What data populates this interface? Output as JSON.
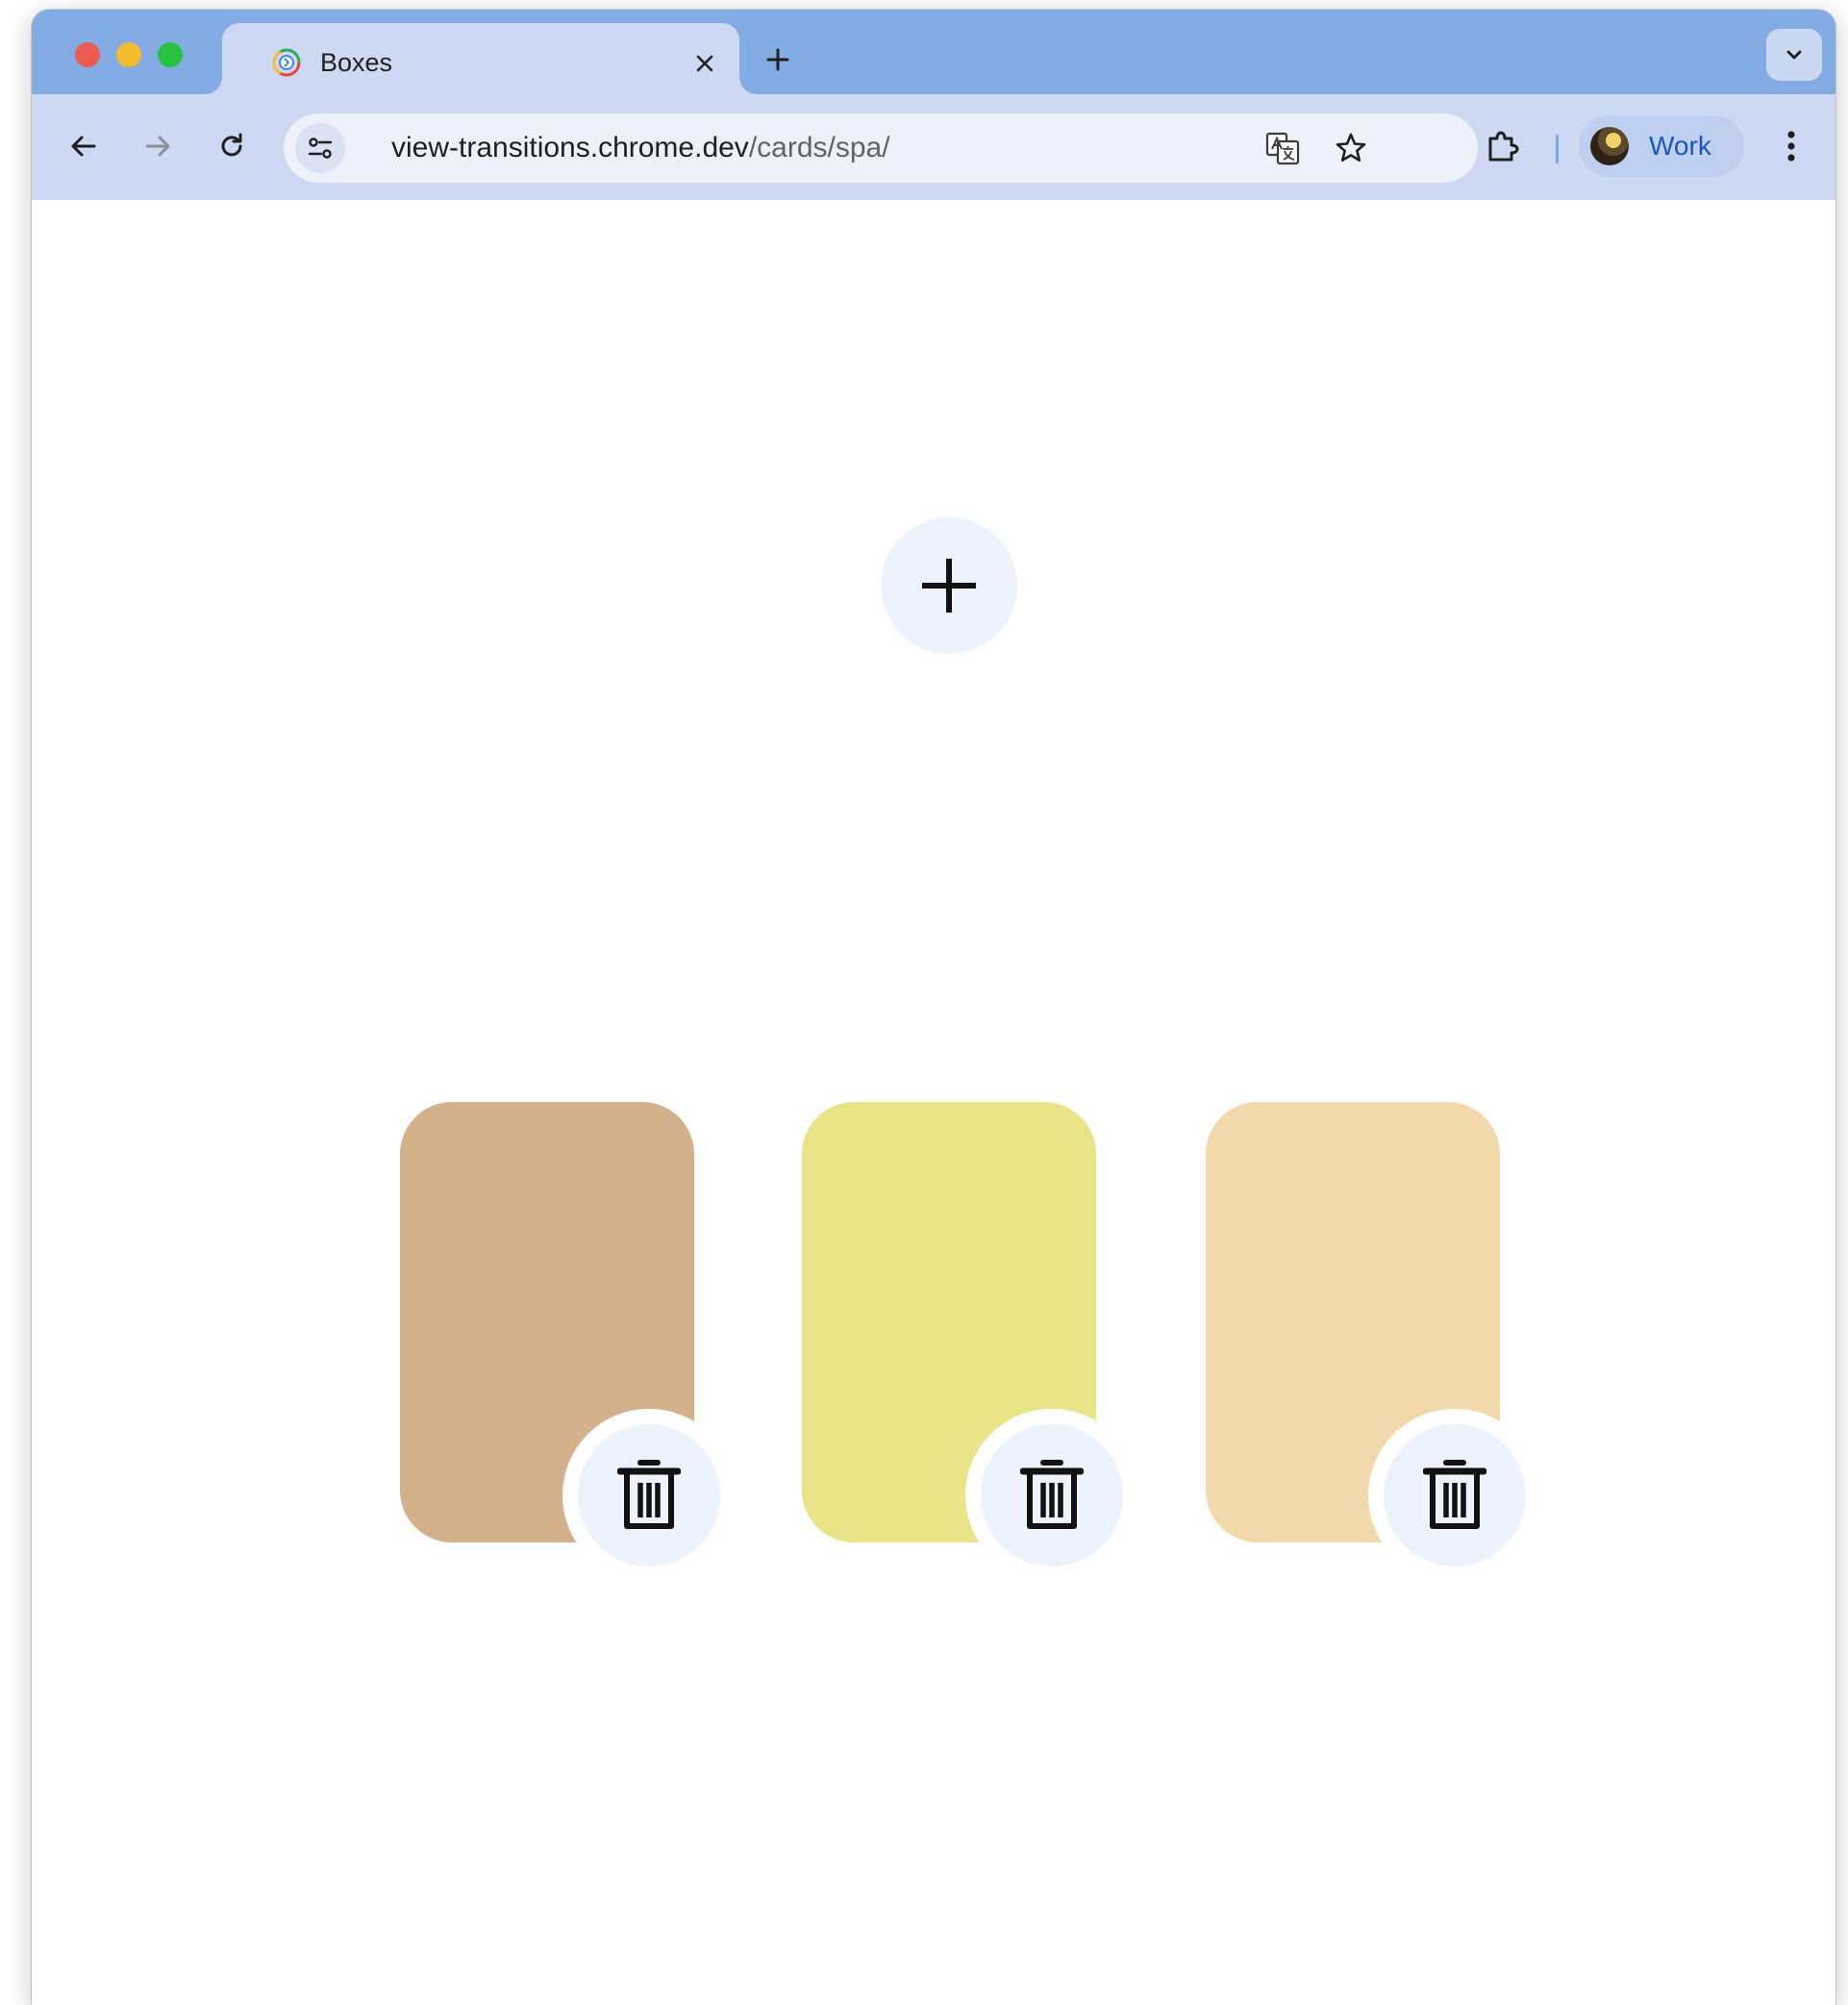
{
  "browser": {
    "tab": {
      "title": "Boxes",
      "favicon": "chrome-dev-icon"
    },
    "new_tab_icon": "plus-icon",
    "tab_search_icon": "chevron-down-icon",
    "nav": {
      "back_icon": "arrow-left-icon",
      "forward_icon": "arrow-right-icon",
      "reload_icon": "reload-icon"
    },
    "url": {
      "host": "view-transitions.chrome.dev",
      "path": "/cards/spa/"
    },
    "omnibox_icons": [
      "translate-icon",
      "star-icon"
    ],
    "extensions_icon": "puzzle-icon",
    "profile": {
      "label": "Work"
    },
    "menu_icon": "kebab-menu-icon"
  },
  "page": {
    "add_button_icon": "plus-icon",
    "cards": [
      {
        "color": "#d3b18a",
        "delete_icon": "trash-icon"
      },
      {
        "color": "#e9e487",
        "delete_icon": "trash-icon"
      },
      {
        "color": "#f2d9ac",
        "delete_icon": "trash-icon"
      }
    ]
  }
}
